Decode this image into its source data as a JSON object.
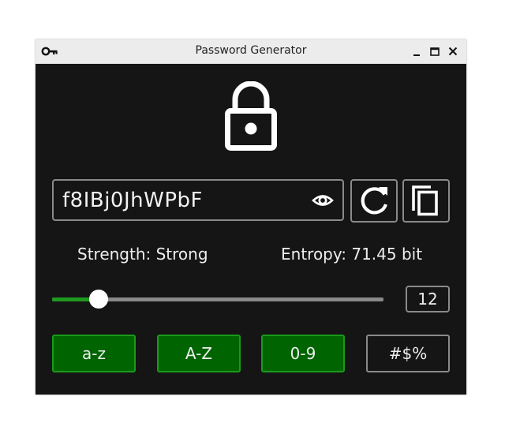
{
  "window": {
    "title": "Password Generator",
    "app_icon": "key-icon",
    "controls": [
      "minimize-icon",
      "maximize-icon",
      "close-icon"
    ]
  },
  "header": {
    "icon": "lock-icon"
  },
  "password": {
    "value": "f8IBj0JhWPbF",
    "toggle_visibility_icon": "eye-icon"
  },
  "actions": {
    "regenerate_icon": "refresh-icon",
    "copy_icon": "copy-icon"
  },
  "stats": {
    "strength": "Strength: Strong",
    "entropy": "Entropy: 71.45 bit"
  },
  "length": {
    "value": "12",
    "slider_fraction": 0.14
  },
  "charsets": [
    {
      "label": "a-z",
      "enabled": true
    },
    {
      "label": "A-Z",
      "enabled": true
    },
    {
      "label": "0-9",
      "enabled": true
    },
    {
      "label": "#$%",
      "enabled": false
    }
  ],
  "colors": {
    "background": "#151515",
    "accent_green": "#006400",
    "accent_border": "#1a9a1a",
    "slider_fill": "#1f9a1f",
    "border_gray": "#8a8a8a"
  }
}
